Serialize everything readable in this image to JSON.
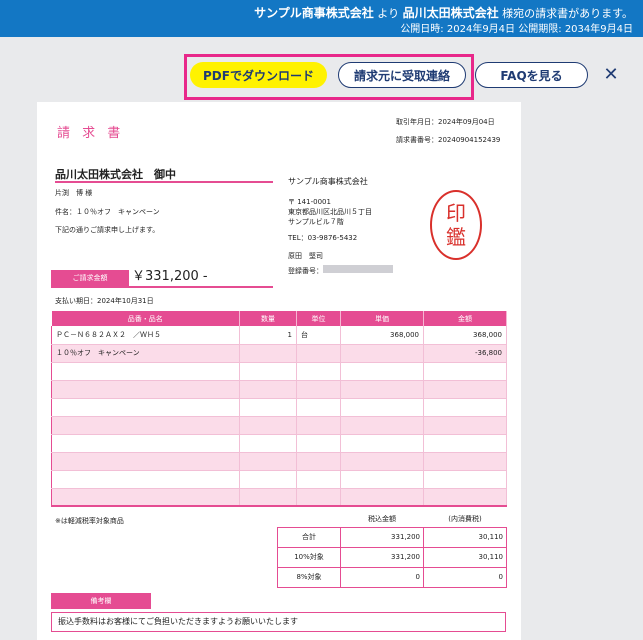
{
  "header": {
    "sender": "サンプル商事株式会社",
    "from_word": "より",
    "recipient": "品川太田株式会社",
    "message_suffix": "様宛の請求書があります。",
    "publish_date_label": "公開日時:",
    "publish_date": "2024年9月4日",
    "publish_until_label": "公開期限:",
    "publish_until": "2034年9月4日",
    "color": "#1377c4"
  },
  "actions": {
    "pdf_label": "PDFでダウンロード",
    "contact_label": "請求元に受取連絡",
    "faq_label": "FAQを見る",
    "close_icon": "close-icon",
    "pdf_color": "#fff200",
    "highlight_color": "#e8288a"
  },
  "invoice": {
    "title": "請 求 書",
    "transaction_date_label": "取引年月日：",
    "transaction_date": "2024年09月04日",
    "invoice_no_label": "請求書番号：",
    "invoice_no": "20240904152439",
    "client": "品川太田株式会社　御中",
    "contact_person": "片渕　博 様",
    "subject_label": "件名：",
    "subject": "１０％オフ　キャンペーン",
    "intro": "下記の通りご請求申し上げます。",
    "amount_label": "ご請求金額",
    "amount": "￥331,200 -",
    "due_label": "支払い期日：",
    "due_date": "2024年10月31日",
    "issuer": {
      "name": "サンプル商事株式会社",
      "postal": "〒 141-0001",
      "address1": "東京都品川区北品川５丁目",
      "address2": "サンプルビル７階",
      "tel": "TEL：03-9876-5432",
      "person": "原田　堅司",
      "reg_label": "登録番号："
    },
    "seal": [
      "印",
      "鑑"
    ],
    "table": {
      "headers": [
        "品番・品名",
        "数量",
        "単位",
        "単価",
        "金額"
      ],
      "rows": [
        [
          "ＰＣ－Ｎ６８２ＡＸ２　／ＷＨ５",
          "1",
          "台",
          "368,000",
          "368,000"
        ],
        [
          "１０％オフ　キャンペーン",
          "",
          "",
          "",
          "-36,800"
        ]
      ]
    },
    "reduced_tax_note": "※は軽減税率対象商品",
    "totals": {
      "col1": "税込金額",
      "col2": "(内消費税)",
      "rows": [
        [
          "合計",
          "331,200",
          "30,110"
        ],
        [
          "10%対象",
          "331,200",
          "30,110"
        ],
        [
          "8%対象",
          "0",
          "0"
        ]
      ]
    },
    "remarks_label": "備考欄",
    "remarks": "振込手数料はお客様にてご負担いただきますようお願いいたします",
    "accent": "#e54c92",
    "seal_color": "#d9302b"
  }
}
